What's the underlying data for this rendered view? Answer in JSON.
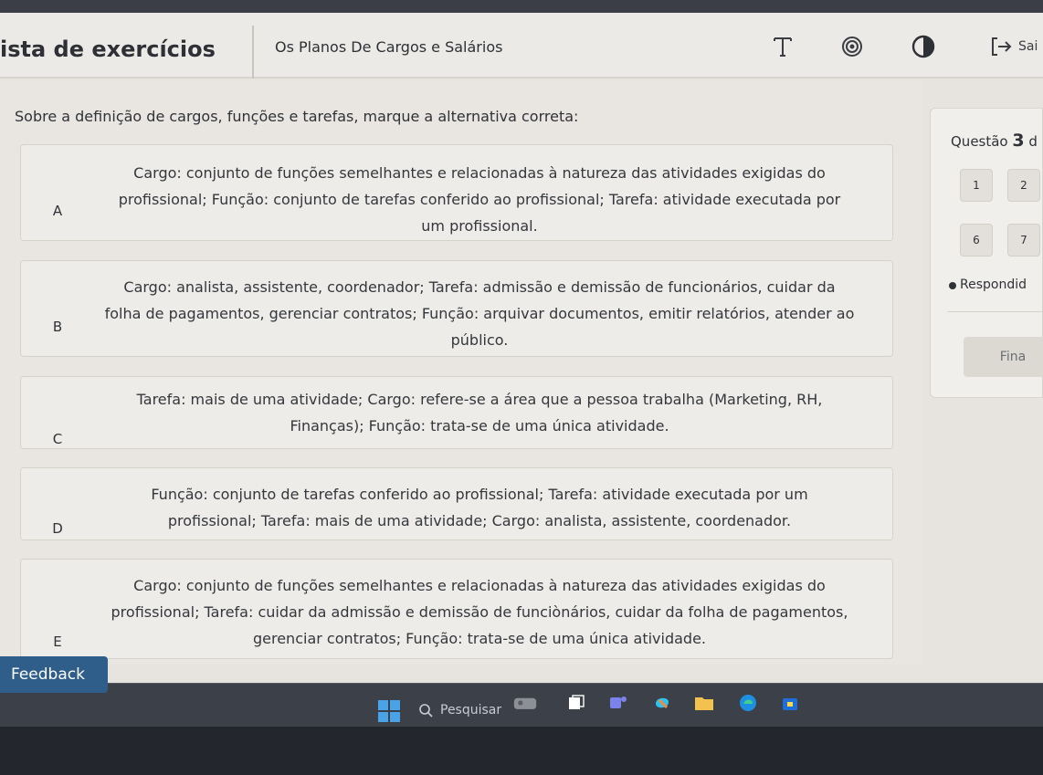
{
  "header": {
    "app_title": "ista de exercícios",
    "course_name": "Os Planos De Cargos e Salários",
    "icons": [
      "font-size-icon",
      "contrast-target-icon",
      "half-circle-icon",
      "logout-icon"
    ],
    "exit_label": "Sai"
  },
  "question": {
    "text": "Sobre a definição de cargos, funções e tarefas, marque a alternativa correta:"
  },
  "options": [
    {
      "letter": "A",
      "lines": [
        "Cargo: conjunto de funções semelhantes e relacionadas à natureza das atividades exigidas do",
        "profissional; Função: conjunto de tarefas conferido ao profissional; Tarefa: atividade executada por",
        "um profissional."
      ]
    },
    {
      "letter": "B",
      "lines": [
        "Cargo: analista, assistente, coordenador; Tarefa: admissão e demissão de funcionários, cuidar da",
        "folha de pagamentos, gerenciar contratos; Função: arquivar documentos, emitir relatórios, atender ao",
        "público."
      ]
    },
    {
      "letter": "C",
      "lines": [
        "Tarefa: mais de uma atividade; Cargo: refere-se a área que a pessoa trabalha (Marketing, RH,",
        "Finanças); Função: trata-se de uma única atividade."
      ]
    },
    {
      "letter": "D",
      "lines": [
        "Função: conjunto de tarefas conferido ao profissional; Tarefa: atividade executada por um",
        "profissional; Tarefa: mais de uma atividade; Cargo: analista, assistente, coordenador."
      ]
    },
    {
      "letter": "E",
      "lines": [
        "Cargo: conjunto de funções semelhantes e relacionadas à natureza das atividades exigidas do",
        "profissional; Tarefa: cuidar da admissão e demissão de funciònários, cuidar da folha de pagamentos,",
        "gerenciar contratos; Função: trata-se de uma única atividade."
      ]
    }
  ],
  "side_panel": {
    "question_prefix": "Questão",
    "question_number": "3",
    "question_suffix": "d",
    "numbers": [
      "1",
      "2",
      "6",
      "7"
    ],
    "legend_label": "Respondid",
    "finalize_label": "Fina"
  },
  "feedback_label": "Feedback",
  "taskbar": {
    "search_placeholder": "Pesquisar"
  },
  "colors": {
    "feedback_bg": "#2f5e8a",
    "taskbar_bg": "#3c4049",
    "page_bg": "#e9e6e1"
  }
}
